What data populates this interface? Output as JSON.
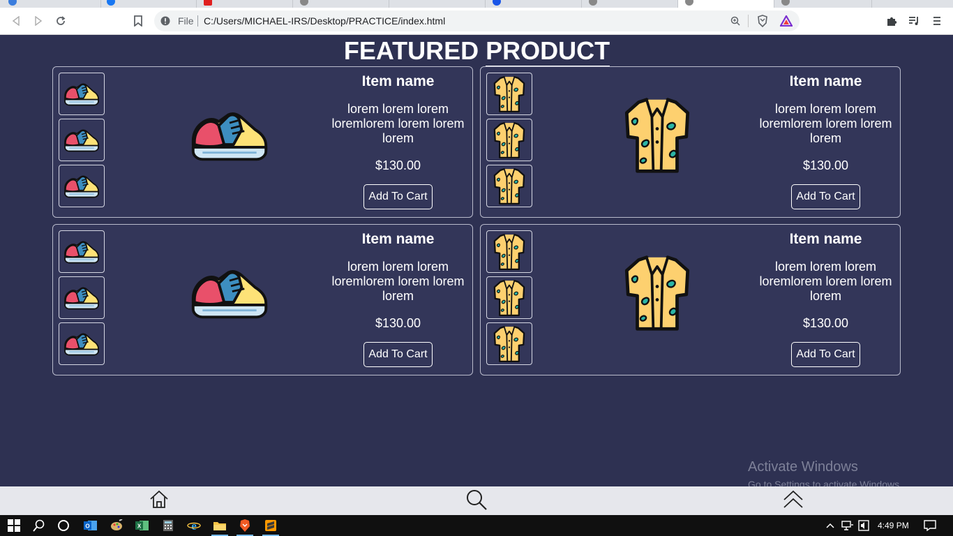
{
  "browser": {
    "file_label": "File",
    "url": "C:/Users/MICHAEL-IRS/Desktop/PRACTICE/index.html"
  },
  "page": {
    "title_first": "FEATURED",
    "title_second": "PRODUCT"
  },
  "products": [
    {
      "image": "sneaker-icon",
      "name": "Item name",
      "description": "lorem lorem lorem loremlorem lorem lorem lorem",
      "price": "$130.00",
      "button": "Add To Cart"
    },
    {
      "image": "shirt-icon",
      "name": "Item name",
      "description": "lorem lorem lorem loremlorem lorem lorem lorem",
      "price": "$130.00",
      "button": "Add To Cart"
    },
    {
      "image": "sneaker-icon",
      "name": "Item name",
      "description": "lorem lorem lorem loremlorem lorem lorem lorem",
      "price": "$130.00",
      "button": "Add To Cart"
    },
    {
      "image": "shirt-icon",
      "name": "Item name",
      "description": "lorem lorem lorem loremlorem lorem lorem lorem",
      "price": "$130.00",
      "button": "Add To Cart"
    }
  ],
  "watermark": {
    "line1": "Activate Windows",
    "line2": "Go to Settings to activate Windows."
  },
  "bottom_nav": {
    "items": [
      "home-icon",
      "search-icon",
      "chevrons-up-icon"
    ]
  },
  "taskbar": {
    "time": "4:49 PM"
  },
  "colors": {
    "page_bg": "#2e3152",
    "card_bg": "#333659",
    "text": "#ffffff"
  }
}
